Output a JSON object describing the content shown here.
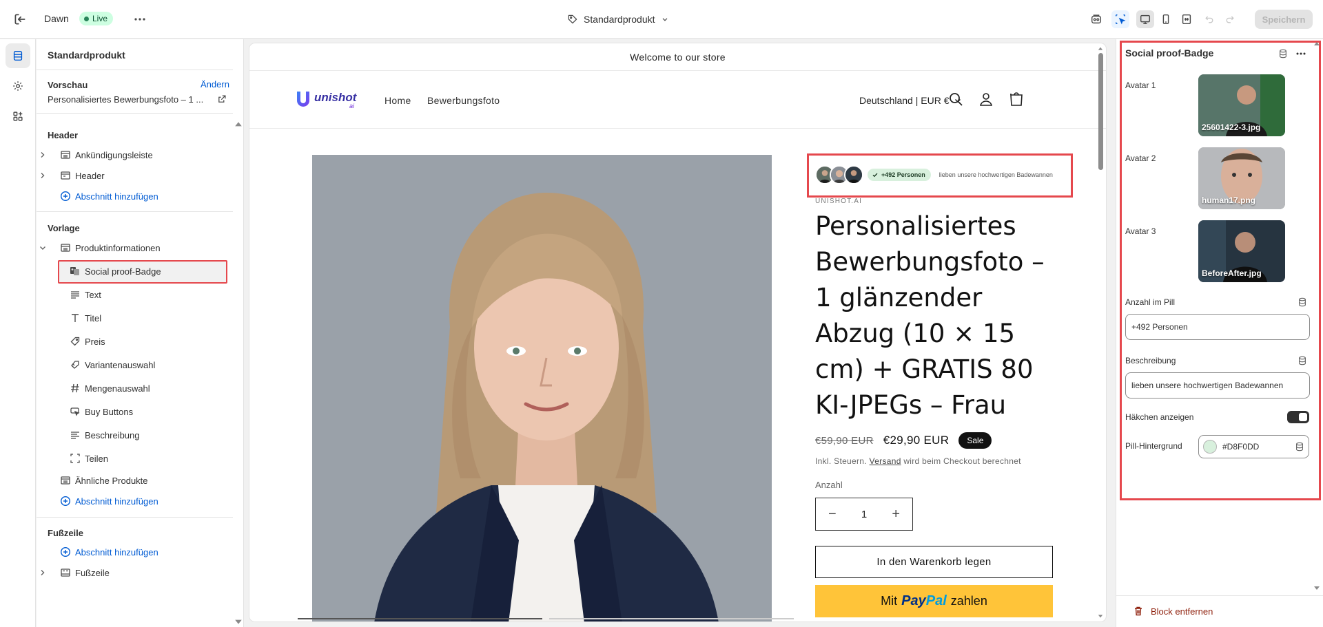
{
  "topbar": {
    "theme_name": "Dawn",
    "live_label": "Live",
    "template_name": "Standardprodukt",
    "save_label": "Speichern"
  },
  "left_panel": {
    "title": "Standardprodukt",
    "preview_heading": "Vorschau",
    "change_label": "Ändern",
    "preview_product": "Personalisiertes Bewerbungsfoto – 1 ...",
    "header_heading": "Header",
    "header_items": [
      "Ankündigungsleiste",
      "Header"
    ],
    "add_section": "Abschnitt hinzufügen",
    "template_heading": "Vorlage",
    "product_info": "Produktinformationen",
    "blocks": [
      "Social proof-Badge",
      "Text",
      "Titel",
      "Preis",
      "Variantenauswahl",
      "Mengenauswahl",
      "Buy Buttons",
      "Beschreibung",
      "Teilen"
    ],
    "related": "Ähnliche Produkte",
    "footer_heading": "Fußzeile",
    "footer_item": "Fußzeile"
  },
  "preview": {
    "announcement": "Welcome to our store",
    "logo_text": "unishot",
    "logo_sub": "ai",
    "nav": [
      "Home",
      "Bewerbungsfoto"
    ],
    "country": "Deutschland | EUR €",
    "badge_count": "+492 Personen",
    "badge_desc": "lieben unsere hochwertigen Badewannen",
    "vendor": "UNISHOT.AI",
    "product_title": "Personalisiertes Bewerbungsfoto – 1 glänzender Abzug (10 × 15 cm) + GRATIS 80 KI-JPEGs – Frau",
    "price_old": "€59,90 EUR",
    "price_new": "€29,90 EUR",
    "sale_label": "Sale",
    "tax_prefix": "Inkl. Steuern.",
    "tax_link": "Versand",
    "tax_suffix": "wird beim Checkout berechnet",
    "qty_label": "Anzahl",
    "qty_minus": "−",
    "qty_value": "1",
    "qty_plus": "+",
    "add_to_cart": "In den Warenkorb legen",
    "paypal_prefix": "Mit",
    "paypal_pay": "Pay",
    "paypal_pal": "Pal",
    "paypal_suffix": "zahlen"
  },
  "right_panel": {
    "title": "Social proof-Badge",
    "avatar1_label": "Avatar 1",
    "avatar1_file": "25601422-3.jpg",
    "avatar2_label": "Avatar 2",
    "avatar2_file": "human17.png",
    "avatar3_label": "Avatar 3",
    "avatar3_file": "BeforeAfter.jpg",
    "pill_count_label": "Anzahl im Pill",
    "pill_count_value": "+492 Personen",
    "description_label": "Beschreibung",
    "description_value": "lieben unsere hochwertigen Badewannen",
    "checkmark_label": "Häkchen anzeigen",
    "checkmark_on": true,
    "pill_bg_label": "Pill-Hintergrund",
    "pill_bg_value": "#D8F0DD",
    "remove_block": "Block entfernen"
  },
  "colors": {
    "accent": "#005bd3",
    "highlight": "#e5484d",
    "live_bg": "#cdfee1",
    "pill_bg": "#D8F0DD",
    "paypal_yellow": "#ffc439",
    "danger": "#8e1f0b"
  },
  "icons": {
    "exit": "exit-icon",
    "more": "more-horizontal-icon",
    "template": "tag-icon",
    "preview_toggles": [
      "sidekick-icon",
      "inspector-icon",
      "desktop-icon",
      "mobile-icon",
      "fullwidth-icon",
      "undo-icon",
      "redo-icon"
    ],
    "rail": [
      "sections-icon",
      "settings-icon",
      "apps-icon"
    ]
  }
}
